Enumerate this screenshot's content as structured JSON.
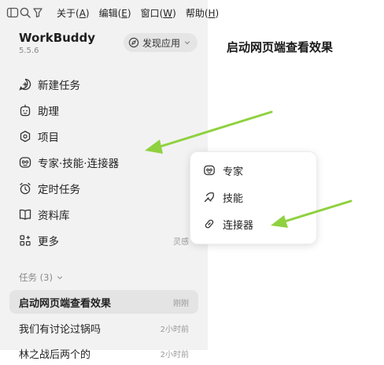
{
  "menubar": {
    "icons": [
      "sidebar-toggle-icon",
      "search-icon",
      "filter-icon"
    ],
    "menus": [
      {
        "label": "关于(",
        "key": "A",
        "tail": ")"
      },
      {
        "label": "编辑(",
        "key": "E",
        "tail": ")"
      },
      {
        "label": "窗口(",
        "key": "W",
        "tail": ")"
      },
      {
        "label": "帮助(",
        "key": "H",
        "tail": ")"
      }
    ]
  },
  "app": {
    "name": "WorkBuddy",
    "version": "5.5.6",
    "discover_label": "发现应用"
  },
  "nav": [
    {
      "label": "新建任务",
      "icon": "new-task-icon"
    },
    {
      "label": "助理",
      "icon": "assistant-icon"
    },
    {
      "label": "项目",
      "icon": "project-icon"
    },
    {
      "label": "专家·技能·连接器",
      "icon": "expert-skill-icon"
    },
    {
      "label": "定时任务",
      "icon": "alarm-icon"
    },
    {
      "label": "资料库",
      "icon": "book-icon"
    },
    {
      "label": "更多",
      "icon": "more-icon",
      "meta": "灵感"
    }
  ],
  "tasks": {
    "section_label": "任务 (3)",
    "items": [
      {
        "title": "启动网页端查看效果",
        "time": "刚刚",
        "active": true
      },
      {
        "title": "我们有讨论过锅吗",
        "time": "2小时前",
        "active": false
      },
      {
        "title": "林之战后两个的",
        "time": "2小时前",
        "active": false
      }
    ]
  },
  "main": {
    "title": "启动网页端查看效果"
  },
  "popup": {
    "items": [
      {
        "label": "专家",
        "icon": "expert-icon"
      },
      {
        "label": "技能",
        "icon": "skill-icon"
      },
      {
        "label": "连接器",
        "icon": "link-icon"
      }
    ]
  },
  "colors": {
    "sidebar_bg": "#f2f2f2",
    "active_row": "#e4e4e4",
    "arrow": "#8fd13f"
  }
}
